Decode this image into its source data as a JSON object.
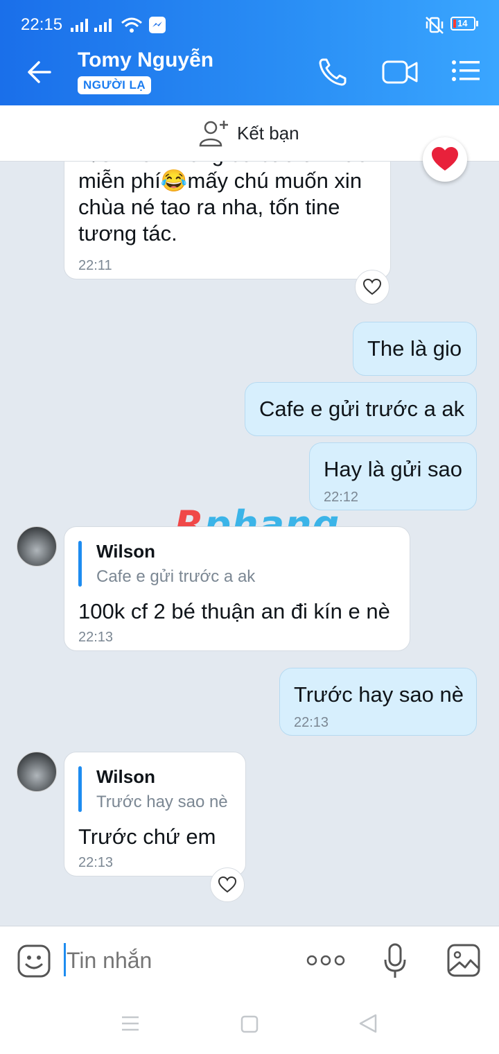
{
  "status_bar": {
    "time": "22:15",
    "battery": "14"
  },
  "header": {
    "contact_name": "Tomy Nguyễn",
    "stranger_badge": "NGƯỜI LẠ"
  },
  "friend_bar": {
    "label": "Kết bạn"
  },
  "messages": [
    {
      "id": "m1",
      "lines": [
        "P/S: Đời không có bữa ăn nào",
        "miễn phí😂mấy chú muốn xin",
        "chùa né tao ra nha, tốn tine",
        "tương tác."
      ],
      "time": "22:11"
    },
    {
      "id": "m2",
      "text": "The là gio"
    },
    {
      "id": "m3",
      "text": "Cafe e gửi trước a ak"
    },
    {
      "id": "m4",
      "text": "Hay là gửi sao",
      "time": "22:12"
    },
    {
      "id": "m5",
      "quote_name": "Wilson",
      "quote_text": "Cafe e gửi trước a ak",
      "text": "100k cf 2 bé thuận an đi kín e nè",
      "time": "22:13"
    },
    {
      "id": "m6",
      "text": "Trước hay sao nè",
      "time": "22:13"
    },
    {
      "id": "m7",
      "quote_name": "Wilson",
      "quote_text": "Trước hay sao nè",
      "text": "Trước chứ em",
      "time": "22:13"
    }
  ],
  "watermark": {
    "prefix": "R",
    "rest": "phang"
  },
  "composer": {
    "placeholder": "Tin nhắn"
  },
  "icons": [
    "back-arrow-icon",
    "phone-icon",
    "video-call-icon",
    "menu-list-icon",
    "add-friend-icon",
    "heart-icon",
    "emoji-icon",
    "more-icon",
    "microphone-icon",
    "image-icon"
  ]
}
